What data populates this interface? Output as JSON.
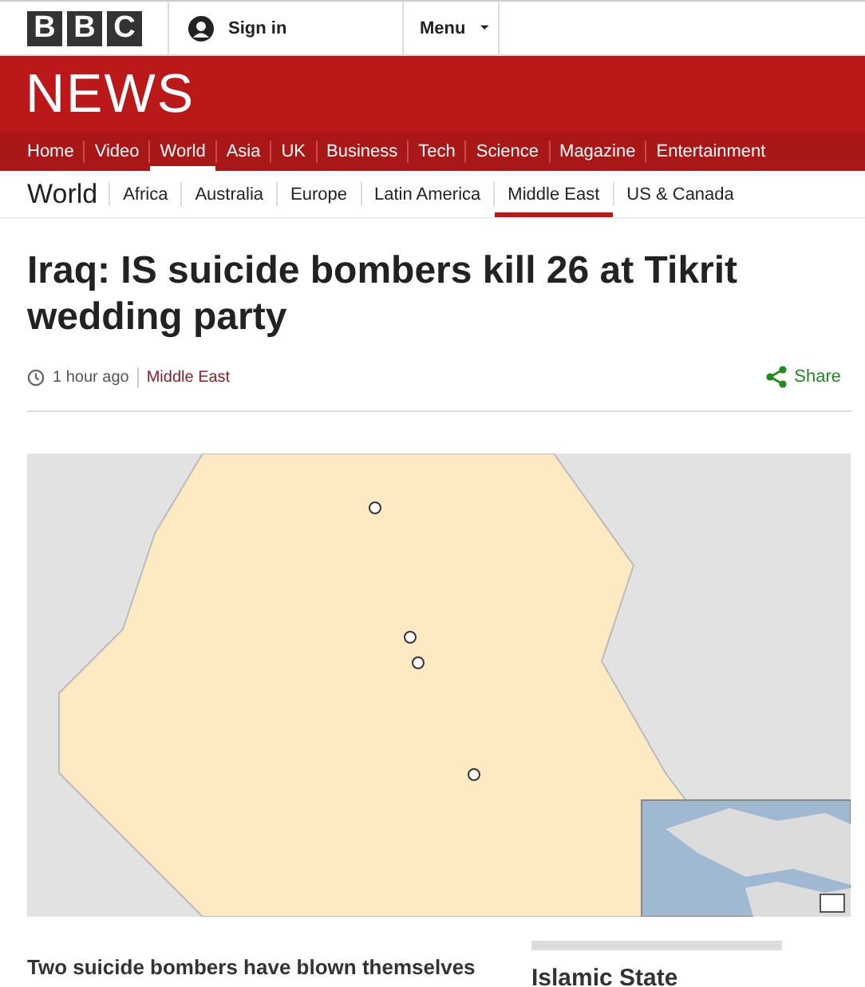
{
  "logo": [
    "B",
    "B",
    "C"
  ],
  "sign_in": "Sign in",
  "menu": "Menu",
  "brand": "NEWS",
  "nav": [
    {
      "label": "Home",
      "selected": false
    },
    {
      "label": "Video",
      "selected": false
    },
    {
      "label": "World",
      "selected": true
    },
    {
      "label": "Asia",
      "selected": false
    },
    {
      "label": "UK",
      "selected": false
    },
    {
      "label": "Business",
      "selected": false
    },
    {
      "label": "Tech",
      "selected": false
    },
    {
      "label": "Science",
      "selected": false
    },
    {
      "label": "Magazine",
      "selected": false
    },
    {
      "label": "Entertainment",
      "selected": false
    }
  ],
  "section": "World",
  "subnav": [
    {
      "label": "Africa",
      "selected": false
    },
    {
      "label": "Australia",
      "selected": false
    },
    {
      "label": "Europe",
      "selected": false
    },
    {
      "label": "Latin America",
      "selected": false
    },
    {
      "label": "Middle East",
      "selected": true
    },
    {
      "label": "US & Canada",
      "selected": false
    }
  ],
  "headline": "Iraq: IS suicide bombers kill 26 at Tikrit wedding party",
  "time": "1 hour ago",
  "tag": "Middle East",
  "share": "Share",
  "intro": "Two suicide bombers have blown themselves",
  "sidebar_title": "Islamic State"
}
